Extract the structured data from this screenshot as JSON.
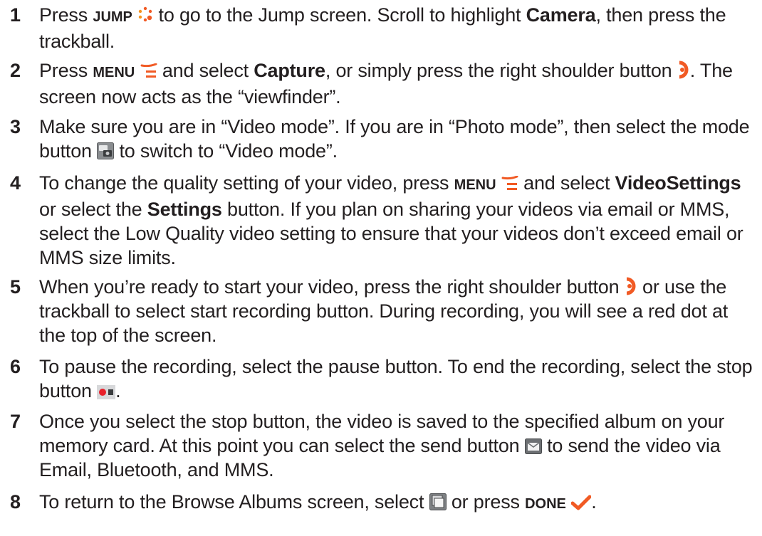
{
  "steps": [
    {
      "number": "1",
      "t1": "Press ",
      "k1": "JUMP",
      "t2": " to go to the Jump screen. Scroll to highlight ",
      "b1": "Camera",
      "t3": ", then press the trackball."
    },
    {
      "number": "2",
      "t1": "Press ",
      "k1": "MENU",
      "t2": " and select ",
      "b1": "Capture",
      "t3": ", or simply press the right shoulder button ",
      "t4": ". The screen now acts as the “viewfinder”."
    },
    {
      "number": "3",
      "t1": "Make sure you are in “Video mode”. If you are in “Photo mode”, then select the mode button ",
      "t2": " to switch to “Video mode”."
    },
    {
      "number": "4",
      "t1": "To change the quality setting of your video, press ",
      "k1": "MENU",
      "t2": " and select ",
      "b1": "VideoSettings",
      "t3": " or select the ",
      "b2": "Settings",
      "t4": " button. If you plan on sharing your videos via email or MMS, select the Low Quality video setting to ensure that your videos don’t exceed email or MMS size limits."
    },
    {
      "number": "5",
      "t1": "When you’re ready to start your video, press the right shoulder button ",
      "t2": " or use the trackball to select start recording button. During recording, you will see a red dot at the top of the screen."
    },
    {
      "number": "6",
      "t1": "To pause the recording, select the pause button. To end the recording, select the stop button ",
      "t2": "."
    },
    {
      "number": "7",
      "t1": "Once you select the stop button, the video is saved to the specified album on your memory card. At this point you can select the send button ",
      "t2": " to send the video via Email, Bluetooth, and MMS."
    },
    {
      "number": "8",
      "t1": "To return to the Browse Albums screen, select ",
      "t2": " or press ",
      "k1": "DONE",
      "t3": "."
    }
  ],
  "icons": {
    "jump": "jump-dots-icon",
    "menu": "menu-lines-icon",
    "shoulder": "right-shoulder-button-icon",
    "mode": "camera-mode-switch-icon",
    "stop": "stop-record-icon",
    "send": "envelope-send-icon",
    "albums": "browse-albums-icon",
    "done": "done-checkmark-icon"
  },
  "colors": {
    "text": "#231f20",
    "accent_orange": "#f15a24",
    "record_red": "#e8202a"
  }
}
